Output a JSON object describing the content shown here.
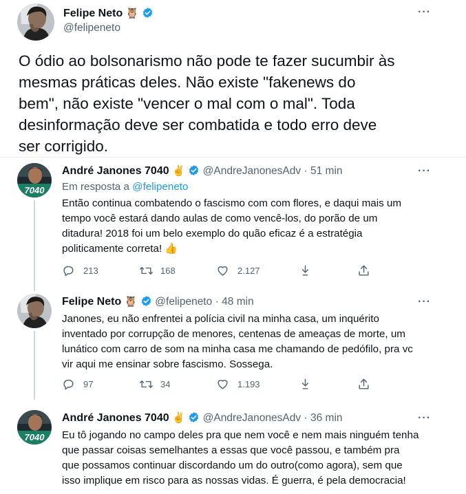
{
  "main_tweet": {
    "author_name": "Felipe Neto",
    "author_emoji": "🦉",
    "handle": "@felipeneto",
    "text_lines": [
      "O ódio ao bolsonarismo não pode te fazer sucumbir às",
      "mesmas práticas deles. Não existe \"fakenews do",
      "bem\", não existe \"vencer o mal com o mal\". Toda",
      "desinformação deve ser combatida e todo erro deve",
      "ser corrigido."
    ]
  },
  "replies": [
    {
      "author_name": "André Janones 7040",
      "author_emoji": "✌",
      "handle": "@AndreJanonesAdv",
      "time": "· 51 min",
      "reply_prefix": "Em resposta a",
      "reply_to": "@felipeneto",
      "text_lines": [
        "Então continua combatendo o fascismo com com flores, e daqui mais um",
        "tempo você estará dando aulas de como vencê-los, do porão de um",
        "ditadura! 2018 foi um belo exemplo do quão eficaz é a estratégia",
        "politicamente correta! 👍"
      ],
      "avatar_badge": "7040",
      "replies": "213",
      "retweets": "168",
      "likes": "2.127"
    },
    {
      "author_name": "Felipe Neto",
      "author_emoji": "🦉",
      "handle": "@felipeneto",
      "time": "· 48 min",
      "text_lines": [
        "Janones, eu não enfrentei a polícia civil na minha casa, um inquérito",
        "inventado por corrupção de menores, centenas de ameaças de morte, um",
        "lunático com carro de som na minha casa me chamando de pedófilo, pra vc",
        "vir aqui me ensinar sobre fascismo. Sossega."
      ],
      "replies": "97",
      "retweets": "34",
      "likes": "1.193"
    },
    {
      "author_name": "André Janones 7040",
      "author_emoji": "✌",
      "handle": "@AndreJanonesAdv",
      "time": "· 36 min",
      "text_lines": [
        "Eu tô jogando no campo deles pra que nem você e nem mais ninguém tenha",
        "que passar coisas semelhantes a essas que você passou, e também pra",
        "que possamos continuar discordando um do outro(como agora), sem que",
        "isso implique em risco para as nossas vidas. É guerra, é pela democracia!"
      ],
      "avatar_badge": "7040"
    }
  ],
  "colors": {
    "verified": "#1d9bf0",
    "link": "#1d9bf0",
    "secondary_text": "#536471"
  }
}
